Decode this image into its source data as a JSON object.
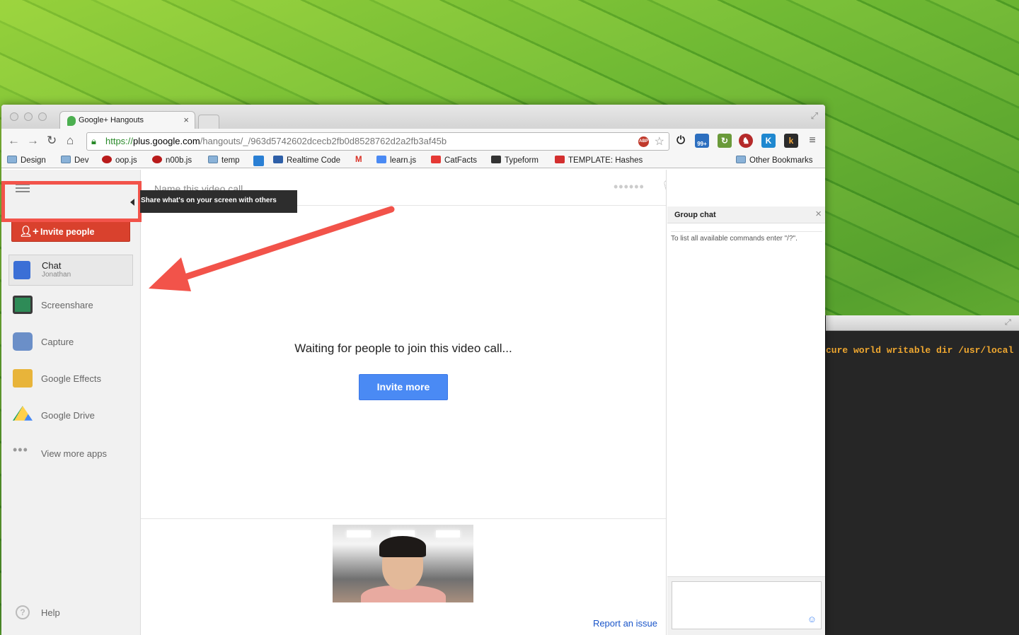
{
  "browser": {
    "tab_title": "Google+ Hangouts",
    "tab_close": "×",
    "url": {
      "scheme": "https://",
      "host": "plus.google.com",
      "path": "/hangouts/_/963d5742602dcecb2fb0d8528762d2a2fb3af45b"
    },
    "nav": {
      "back": "←",
      "forward": "→",
      "reload": "↻",
      "home": "⌂"
    },
    "extensions": {
      "abp": "ABP",
      "badge": "99+",
      "k_blue": "K",
      "k_dark": "k",
      "menu": "≡"
    },
    "bookmarks": [
      {
        "label": "Design",
        "icon": "folder-icon"
      },
      {
        "label": "Dev",
        "icon": "folder-icon"
      },
      {
        "label": "oop.js",
        "icon": "bird-icon"
      },
      {
        "label": "n00b.js",
        "icon": "bird-icon"
      },
      {
        "label": "temp",
        "icon": "folder-icon"
      },
      {
        "label": "Realtime Code",
        "icon": "doc-icon"
      },
      {
        "label": "learn.js",
        "icon": "doc-icon"
      },
      {
        "label": "CatFacts",
        "icon": "bf-icon"
      },
      {
        "label": "Typeform",
        "icon": "typeform-icon"
      },
      {
        "label": "TEMPLATE: Hashes",
        "icon": "template-icon"
      },
      {
        "label": "Other Bookmarks",
        "icon": "folder-icon"
      }
    ]
  },
  "hangout": {
    "call_name_placeholder": "Name this video call...",
    "invite_button": "Invite people",
    "apps": [
      {
        "label": "Chat",
        "sub": "Jonathan"
      },
      {
        "label": "Screenshare"
      },
      {
        "label": "Capture"
      },
      {
        "label": "Google Effects"
      },
      {
        "label": "Google Drive"
      },
      {
        "label": "View more apps"
      }
    ],
    "tooltip": "Share what's on your screen with others",
    "help": "Help",
    "help_icon": "?",
    "waiting_text": "Waiting for people to join this video call...",
    "invite_more": "Invite more",
    "report_issue": "Report an issue",
    "group_chat_title": "Group chat",
    "group_chat_close": "×",
    "chat_hint": "To list all available commands enter \"/?\".",
    "emoji": "☺"
  },
  "terminal": {
    "line": "cure world writable dir /usr/local in"
  },
  "colors": {
    "accent_red": "#d9412d",
    "accent_blue": "#4a8af4",
    "highlight": "#f2534a",
    "terminal_text": "#f0a830"
  }
}
